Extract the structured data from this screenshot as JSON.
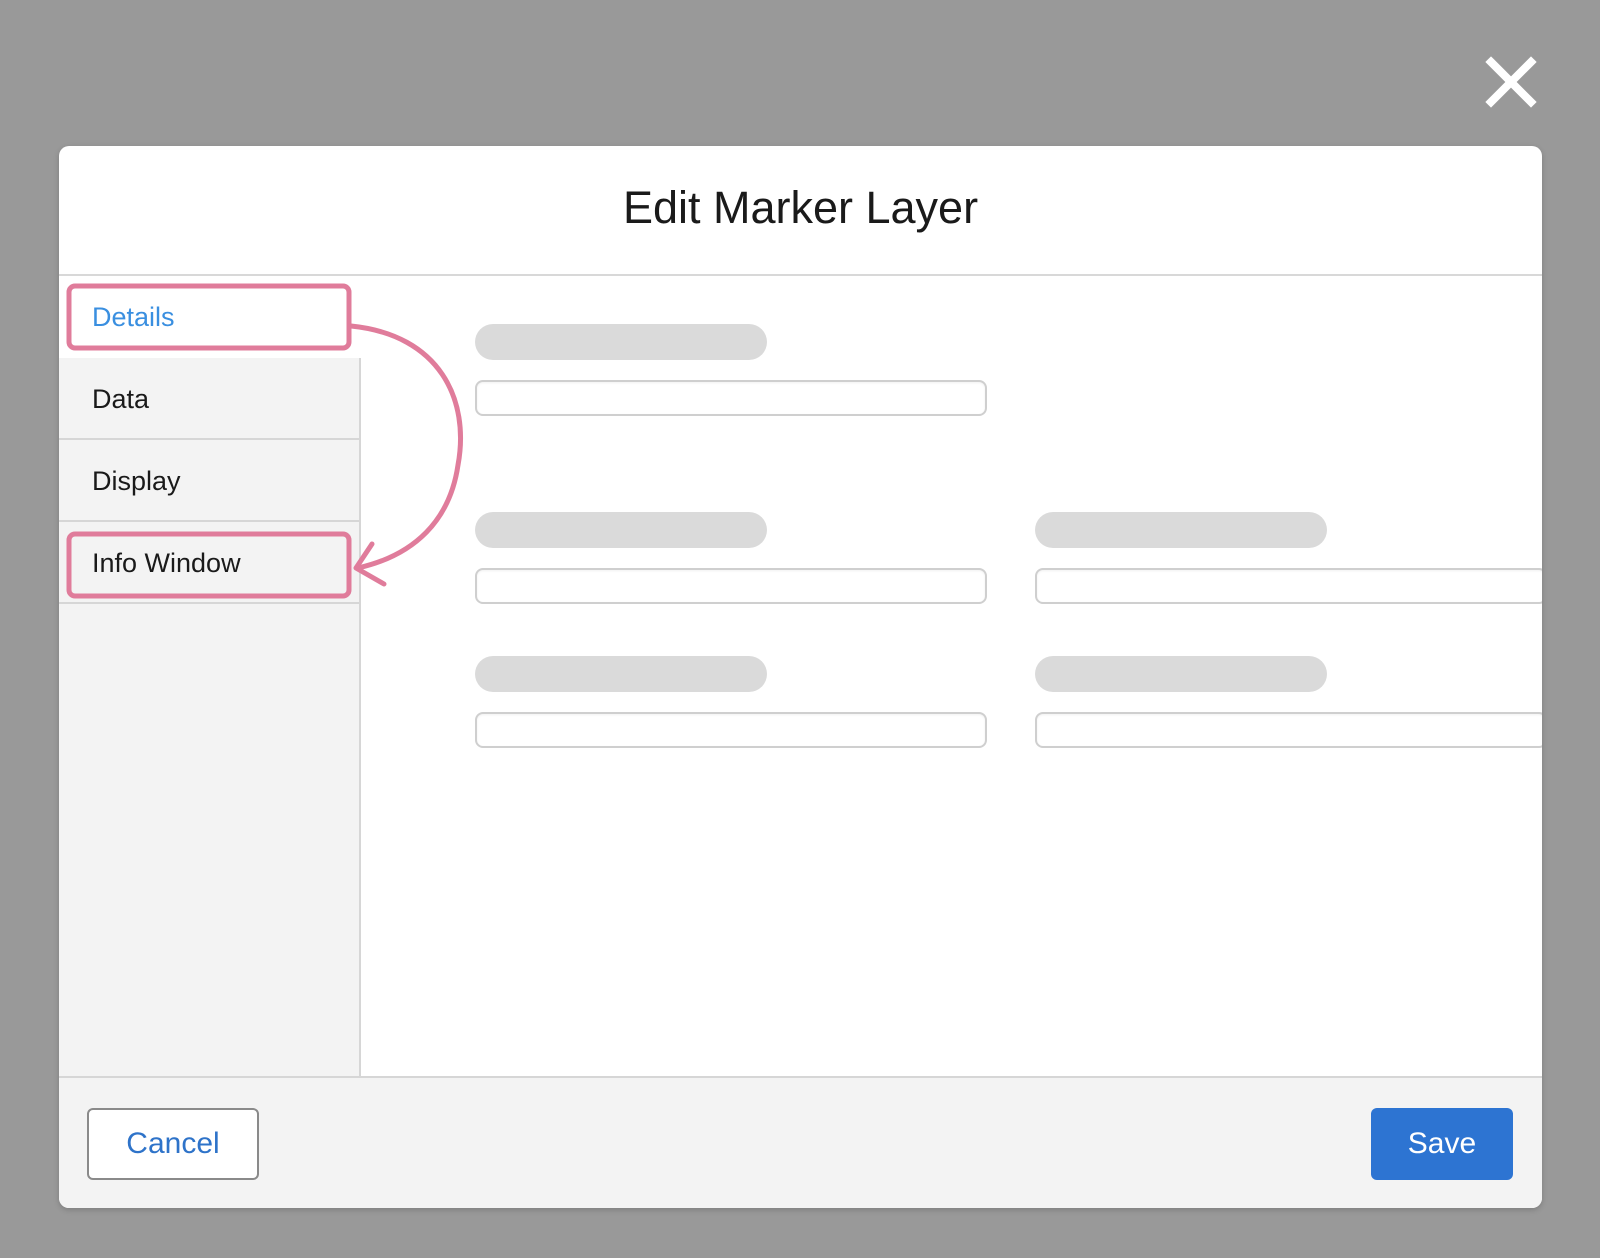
{
  "dialog": {
    "title": "Edit Marker Layer"
  },
  "sidebar": {
    "items": [
      {
        "label": "Details",
        "active": true
      },
      {
        "label": "Data",
        "active": false
      },
      {
        "label": "Display",
        "active": false
      },
      {
        "label": "Info Window",
        "active": false
      }
    ]
  },
  "footer": {
    "cancel_label": "Cancel",
    "save_label": "Save"
  },
  "icons": {
    "close": "close-icon"
  },
  "colors": {
    "backdrop": "#999999",
    "active_tab": "#3a8fe0",
    "primary_button": "#2d74d2",
    "highlight_annotation": "#e07c9b"
  }
}
